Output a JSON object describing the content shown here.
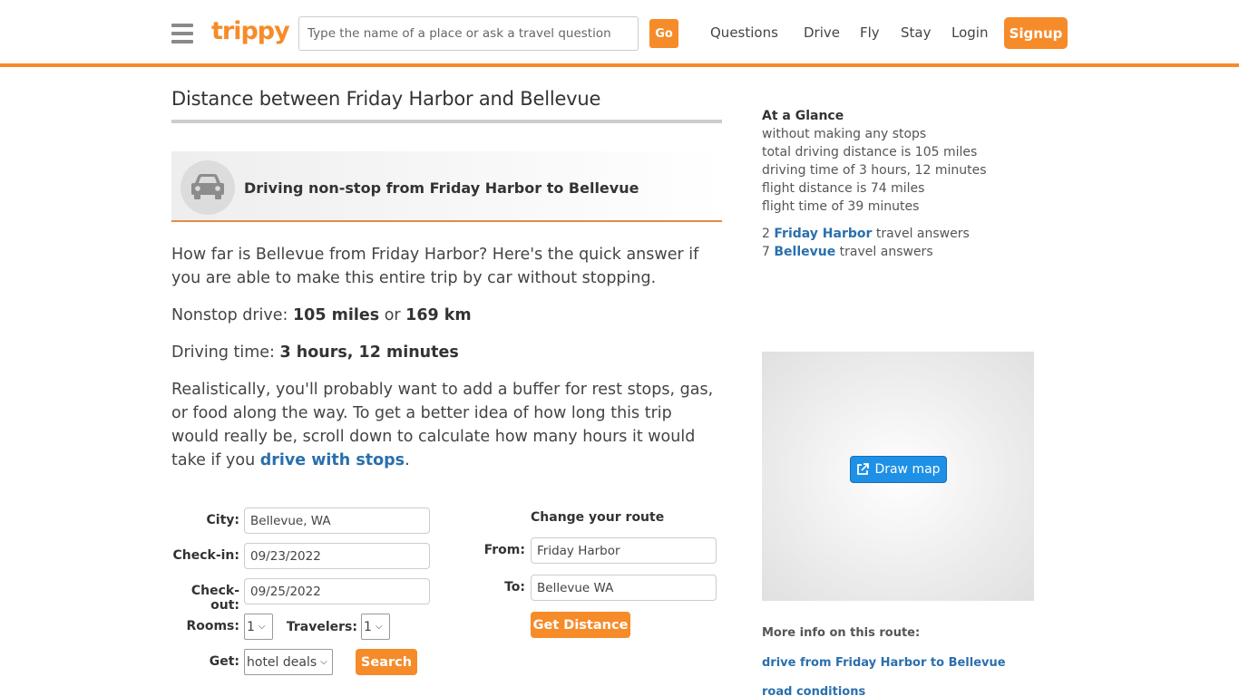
{
  "header": {
    "logo": "trippy",
    "search_placeholder": "Type the name of a place or ask a travel question",
    "go_label": "Go",
    "nav": [
      "Questions",
      "Drive",
      "Fly",
      "Stay",
      "Login"
    ],
    "signup_label": "Signup",
    "accent_color": "#f68b2a"
  },
  "main": {
    "title": "Distance between Friday Harbor and Bellevue",
    "banner": {
      "icon": "car-icon",
      "text": "Driving non-stop from Friday Harbor to Bellevue"
    },
    "intro": "How far is Bellevue from Friday Harbor? Here's the quick answer if you are able to make this entire trip by car without stopping.",
    "nonstop": {
      "label": "Nonstop drive: ",
      "miles": "105 miles",
      "or": " or ",
      "km": "169 km"
    },
    "driving_time": {
      "label": "Driving time: ",
      "value": "3 hours, 12 minutes"
    },
    "realistic": "Realistically, you'll probably want to add a buffer for rest stops, gas, or food along the way. To get a better idea of how long this trip would really be, scroll down to calculate how many hours it would take if you ",
    "realistic_link": "drive with stops",
    "realistic_end": "."
  },
  "hotel_form": {
    "city_label": "City:",
    "city_value": "Bellevue, WA",
    "checkin_label": "Check-in:",
    "checkin_value": "09/23/2022",
    "checkout_label": "Check-out:",
    "checkout_value": "09/25/2022",
    "rooms_label": "Rooms:",
    "rooms_value": "1",
    "travelers_label": "Travelers:",
    "travelers_value": "1",
    "get_label": "Get:",
    "get_value": "hotel deals",
    "search_label": "Search"
  },
  "route_form": {
    "heading": "Change your route",
    "from_label": "From:",
    "from_value": "Friday Harbor",
    "to_label": "To:",
    "to_value": "Bellevue WA",
    "submit_label": "Get Distance"
  },
  "sidebar": {
    "glance_title": "At a Glance",
    "glance_lines": [
      "without making any stops",
      "total driving distance is 105 miles",
      "driving time of 3 hours, 12 minutes",
      "flight distance is 74 miles",
      "flight time of 39 minutes"
    ],
    "answers": [
      {
        "count": "2",
        "place": "Friday Harbor",
        "suffix": " travel answers"
      },
      {
        "count": "7",
        "place": "Bellevue",
        "suffix": " travel answers"
      }
    ],
    "draw_map_label": "Draw map",
    "more_info_label": "More info on this route:",
    "links": [
      "drive from Friday Harbor to Bellevue",
      "road conditions"
    ]
  }
}
